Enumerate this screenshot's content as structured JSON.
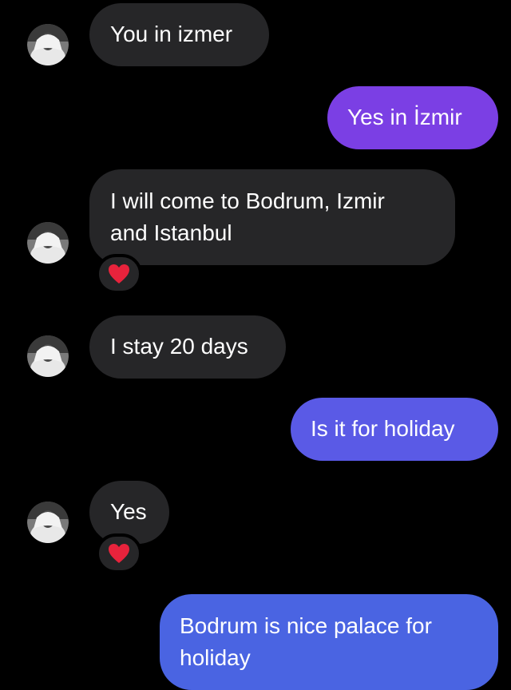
{
  "conversation": {
    "messages": [
      {
        "sender": "contact",
        "text": "You in izmer"
      },
      {
        "sender": "me",
        "text": "Yes in İzmir"
      },
      {
        "sender": "contact",
        "lines": [
          "I will come to Bodrum, Izmir",
          "and Istanbul"
        ],
        "reaction": "heart"
      },
      {
        "sender": "contact",
        "text": "I stay 20 days"
      },
      {
        "sender": "me",
        "text": "Is it for holiday"
      },
      {
        "sender": "contact",
        "text": "Yes",
        "reaction": "heart"
      },
      {
        "sender": "me",
        "lines": [
          "Bodrum is nice palace for",
          "holiday"
        ]
      }
    ]
  },
  "theme": {
    "background": "#000000",
    "incoming_bubble": "#262628",
    "outgoing_gradient": [
      "#7b3fe4",
      "#5a5ae6",
      "#4a64e2"
    ],
    "reaction_heart": "#e8233c"
  },
  "icons": {
    "avatar": "contact-avatar-icon",
    "reaction": "red-heart-icon"
  }
}
